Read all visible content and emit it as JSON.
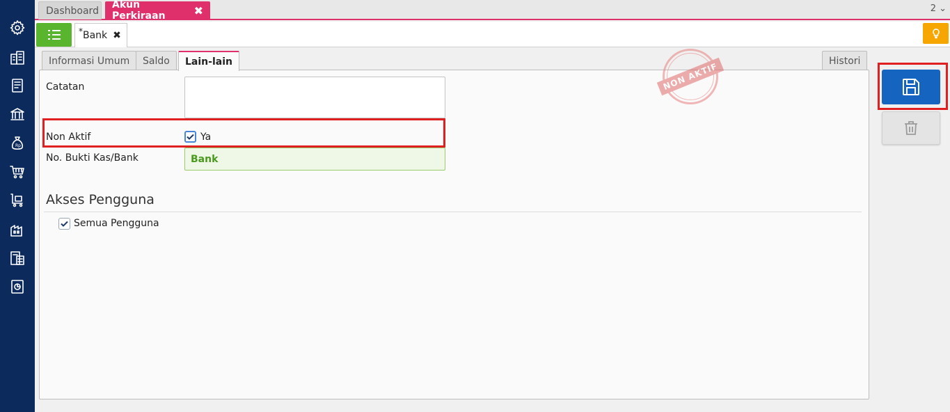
{
  "sidebar": {
    "items": [
      {
        "icon": "gear-icon"
      },
      {
        "icon": "building-icon"
      },
      {
        "icon": "ledger-book-icon"
      },
      {
        "icon": "bank-icon"
      },
      {
        "icon": "money-bag-icon"
      },
      {
        "icon": "shopping-cart-icon"
      },
      {
        "icon": "purchase-cart-icon"
      },
      {
        "icon": "warehouse-icon"
      },
      {
        "icon": "tax-document-icon"
      },
      {
        "icon": "report-chart-icon"
      }
    ]
  },
  "topbar": {
    "tabs": [
      {
        "label": "Dashboard"
      },
      {
        "label": "Akun Perkiraan",
        "close": "✖"
      }
    ],
    "counter": "2 ⌄"
  },
  "subbar": {
    "doc_tab": {
      "modified_mark": "*",
      "label": "Bank",
      "close": "✖"
    }
  },
  "form": {
    "tabs": [
      {
        "label": "Informasi Umum"
      },
      {
        "label": "Saldo"
      },
      {
        "label": "Lain-lain",
        "active": true
      },
      {
        "label": "Histori"
      }
    ],
    "catatan_label": "Catatan",
    "catatan_value": "",
    "non_aktif_label": "Non Aktif",
    "non_aktif_option": "Ya",
    "non_aktif_checked": true,
    "bukti_label": "No. Bukti Kas/Bank",
    "bukti_value": "Bank",
    "section_title": "Akses Pengguna",
    "semua_pengguna_label": "Semua Pengguna",
    "semua_pengguna_checked": true
  },
  "stamp": {
    "text": "NON AKTIF"
  },
  "colors": {
    "sidebar_bg": "#0d2a5c",
    "accent_pink": "#e0306c",
    "list_btn_green": "#5ab52e",
    "bulb_orange": "#f7a600",
    "save_blue": "#1565c0",
    "highlight_red": "#e02020"
  }
}
